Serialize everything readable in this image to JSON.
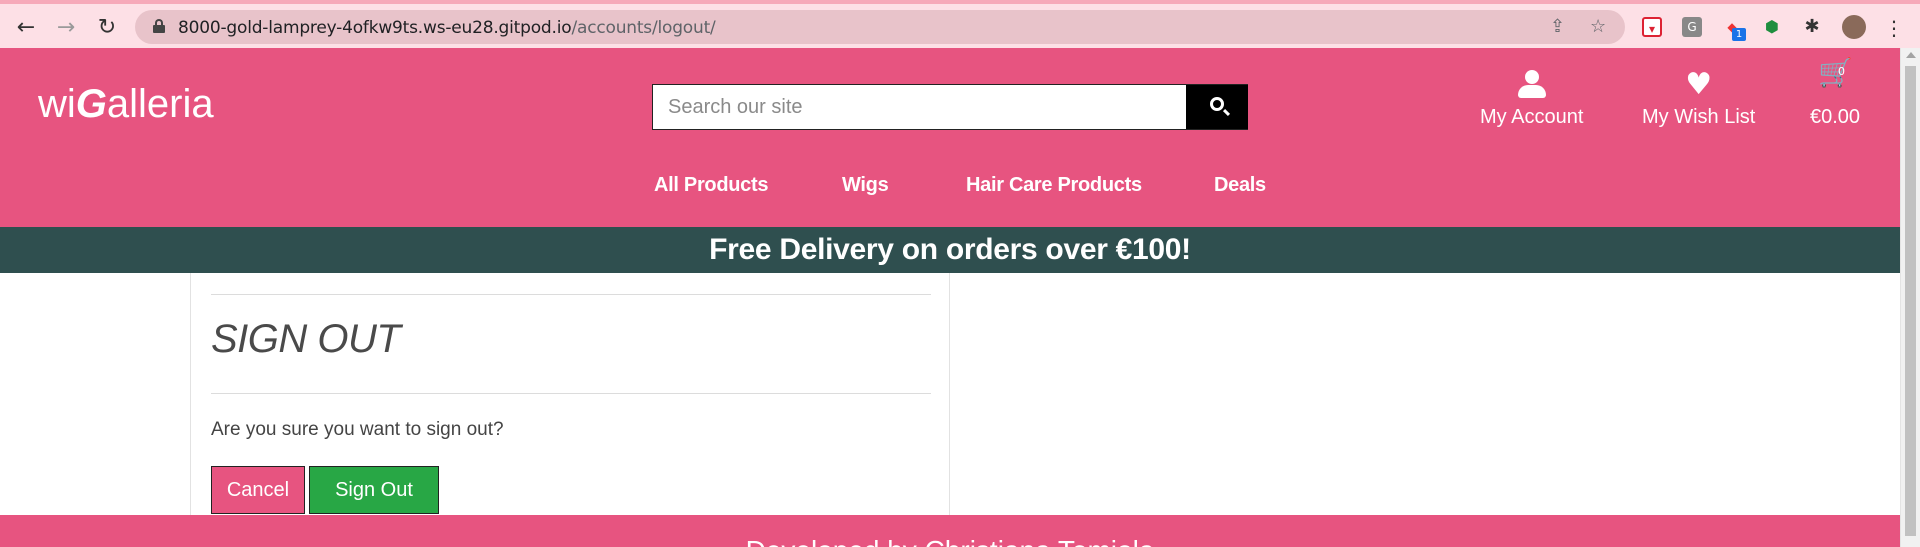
{
  "browser": {
    "url_host": "8000-gold-lamprey-4ofkw9ts.ws-eu28.gitpod.io",
    "url_path": "/accounts/logout/",
    "extension_badge": "1",
    "extension_g": "G"
  },
  "site": {
    "logo_pre": "wi",
    "logo_g": "G",
    "logo_post": "alleria",
    "search_placeholder": "Search our site",
    "account_label": "My Account",
    "wishlist_label": "My Wish List",
    "cart_total": "€0.00",
    "cart_count": "0",
    "nav": [
      "All Products",
      "Wigs",
      "Hair Care Products",
      "Deals"
    ],
    "banner": "Free Delivery on orders over €100!",
    "colors": {
      "brand_pink": "#e75480",
      "banner_dark": "#2f4f4f",
      "success_green": "#28a745"
    }
  },
  "main": {
    "title": "SIGN OUT",
    "question": "Are you sure you want to sign out?",
    "cancel_label": "Cancel",
    "signout_label": "Sign Out"
  },
  "footer": {
    "text": "Developed by Christiana Temiola"
  }
}
